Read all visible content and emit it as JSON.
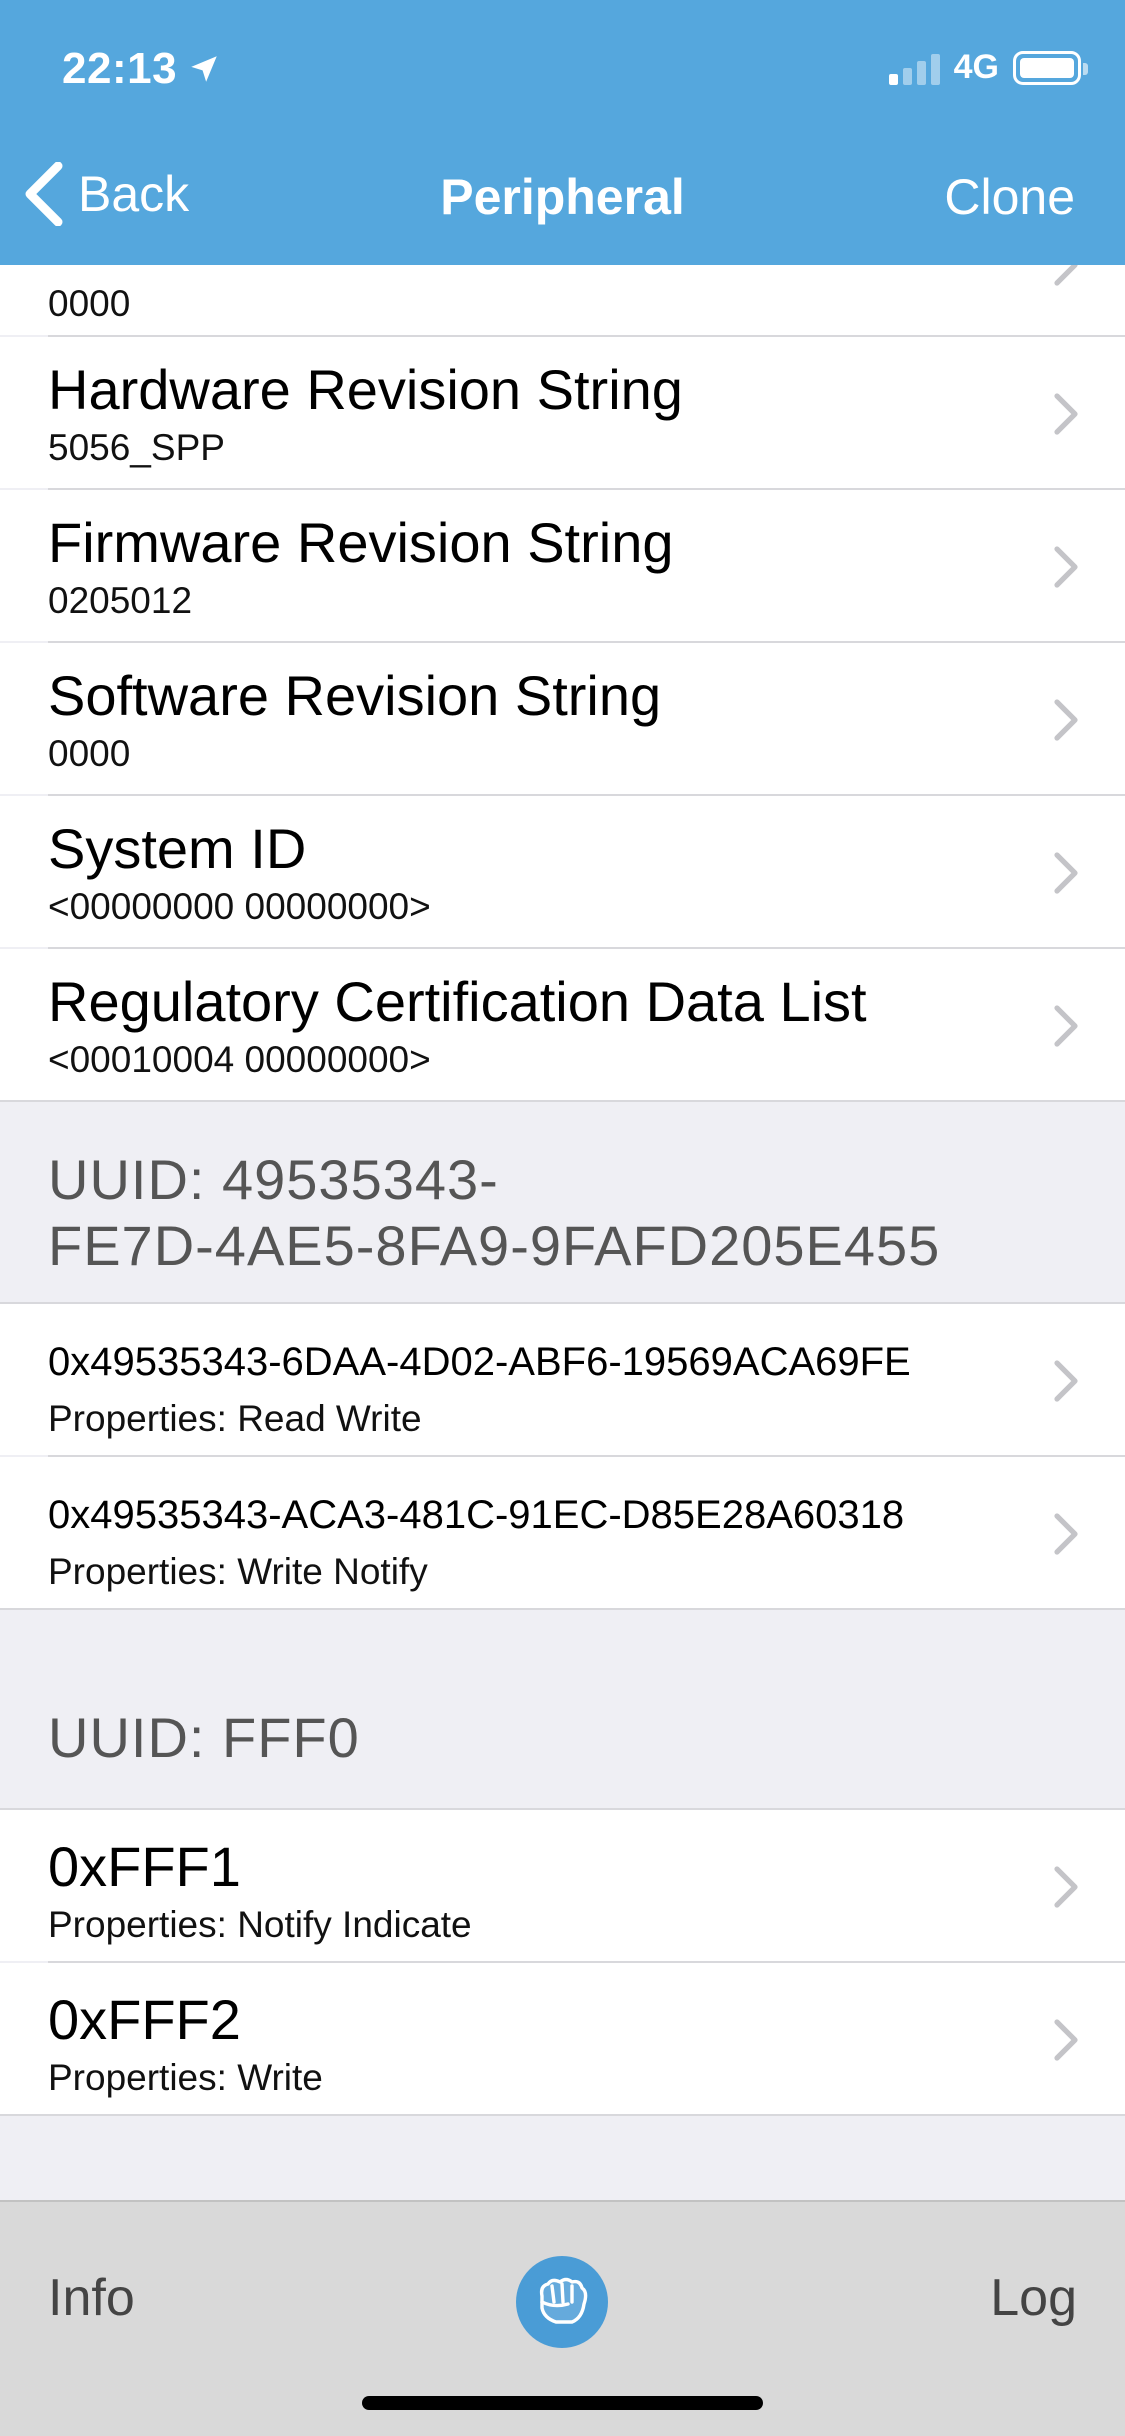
{
  "status_bar": {
    "time": "22:13",
    "network": "4G",
    "signal_bars": 4,
    "signal_bars_active": 1,
    "battery_level": 1.0
  },
  "nav": {
    "back_label": "Back",
    "title": "Peripheral",
    "clone_label": "Clone"
  },
  "info_rows": [
    {
      "title": "",
      "value": "0000"
    },
    {
      "title": "Hardware Revision String",
      "value": "5056_SPP"
    },
    {
      "title": "Firmware Revision String",
      "value": "0205012"
    },
    {
      "title": "Software Revision String",
      "value": "0000"
    },
    {
      "title": "System ID",
      "value": "<00000000 00000000>"
    },
    {
      "title": "Regulatory Certification Data List",
      "value": "<00010004 00000000>"
    }
  ],
  "services": [
    {
      "title_line1": "UUID: 49535343-",
      "title_line2": "FE7D-4AE5-8FA9-9FAFD205E455",
      "characteristics": [
        {
          "uuid": "0x49535343-6DAA-4D02-ABF6-19569ACA69FE",
          "properties": "Properties: Read Write"
        },
        {
          "uuid": "0x49535343-ACA3-481C-91EC-D85E28A60318",
          "properties": "Properties: Write Notify"
        }
      ]
    },
    {
      "title_line1": "UUID: FFF0",
      "characteristics": [
        {
          "uuid": "0xFFF1",
          "properties": "Properties: Notify Indicate"
        },
        {
          "uuid": "0xFFF2",
          "properties": "Properties: Write"
        }
      ]
    }
  ],
  "tabbar": {
    "left_label": "Info",
    "right_label": "Log",
    "center_icon": "fist-icon"
  },
  "colors": {
    "accent": "#55a7dd",
    "tab_icon": "#4a9cd6",
    "background": "#efeff4"
  }
}
